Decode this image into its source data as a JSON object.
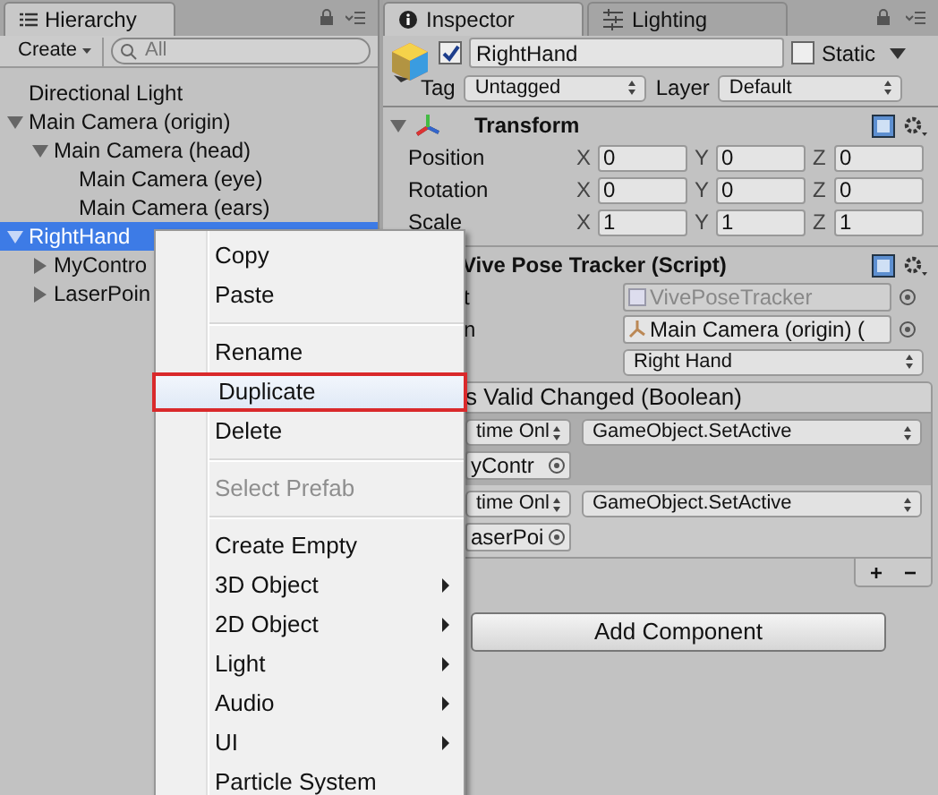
{
  "hierarchy": {
    "tab": "Hierarchy",
    "create": "Create",
    "search": {
      "placeholder": "All"
    },
    "items": [
      {
        "label": "Directional Light",
        "selected": false
      },
      {
        "label": "Main Camera (origin)",
        "expanded": true,
        "selected": false,
        "children": [
          {
            "label": "Main Camera (head)",
            "expanded": true,
            "selected": false,
            "children": [
              {
                "label": "Main Camera (eye)",
                "selected": false
              },
              {
                "label": "Main Camera (ears)",
                "selected": false
              }
            ]
          }
        ]
      },
      {
        "label": "RightHand",
        "expanded": true,
        "selected": true,
        "children": [
          {
            "label": "MyContro",
            "expanded": false,
            "selected": false
          },
          {
            "label": "LaserPoin",
            "expanded": false,
            "selected": false
          }
        ]
      }
    ]
  },
  "inspector": {
    "tabs": [
      {
        "label": "Inspector",
        "selected": true
      },
      {
        "label": "Lighting",
        "selected": false
      }
    ],
    "object": {
      "active": true,
      "name": "RightHand",
      "static": false,
      "static_label": "Static",
      "tag_label": "Tag",
      "tag": "Untagged",
      "layer_label": "Layer",
      "layer": "Default"
    },
    "transform": {
      "title": "Transform",
      "expanded": true,
      "rows": [
        {
          "label": "Position",
          "fields": [
            {
              "axis": "X",
              "value": "0"
            },
            {
              "axis": "Y",
              "value": "0"
            },
            {
              "axis": "Z",
              "value": "0"
            }
          ]
        },
        {
          "label": "Rotation",
          "fields": [
            {
              "axis": "X",
              "value": "0"
            },
            {
              "axis": "Y",
              "value": "0"
            },
            {
              "axis": "Z",
              "value": "0"
            }
          ]
        },
        {
          "label": "Scale",
          "fields": [
            {
              "axis": "X",
              "value": "1"
            },
            {
              "axis": "Y",
              "value": "1"
            },
            {
              "axis": "Z",
              "value": "1"
            }
          ]
        }
      ]
    },
    "script": {
      "title": "Vive Pose Tracker (Script)",
      "fields": [
        {
          "label": "t",
          "value": "VivePoseTracker",
          "kind": "script"
        },
        {
          "label": "n",
          "value": "Main Camera (origin) (",
          "kind": "object"
        },
        {
          "value": "Right Hand",
          "kind": "dropdown"
        }
      ],
      "event": {
        "title": "s Valid Changed (Boolean)",
        "listeners": [
          {
            "runtime": "time Onl",
            "function": "GameObject.SetActive",
            "target": "yContr",
            "selected": true
          },
          {
            "runtime": "time Onl",
            "function": "GameObject.SetActive",
            "target": "aserPoi",
            "selected": false
          }
        ],
        "add": "+",
        "remove": "−"
      }
    },
    "add_component": "Add Component"
  },
  "context_menu": [
    {
      "kind": "item",
      "label": "Copy",
      "disabled": false,
      "selected": false,
      "submenu": false
    },
    {
      "kind": "item",
      "label": "Paste",
      "disabled": false,
      "selected": false,
      "submenu": false
    },
    {
      "kind": "separator"
    },
    {
      "kind": "item",
      "label": "Rename",
      "disabled": false,
      "selected": false,
      "submenu": false
    },
    {
      "kind": "item",
      "label": "Duplicate",
      "disabled": false,
      "selected": true,
      "submenu": false
    },
    {
      "kind": "item",
      "label": "Delete",
      "disabled": false,
      "selected": false,
      "submenu": false
    },
    {
      "kind": "separator"
    },
    {
      "kind": "item",
      "label": "Select Prefab",
      "disabled": true,
      "selected": false,
      "submenu": false
    },
    {
      "kind": "separator"
    },
    {
      "kind": "item",
      "label": "Create Empty",
      "disabled": false,
      "selected": false,
      "submenu": false
    },
    {
      "kind": "item",
      "label": "3D Object",
      "disabled": false,
      "selected": false,
      "submenu": true
    },
    {
      "kind": "item",
      "label": "2D Object",
      "disabled": false,
      "selected": false,
      "submenu": true
    },
    {
      "kind": "item",
      "label": "Light",
      "disabled": false,
      "selected": false,
      "submenu": true
    },
    {
      "kind": "item",
      "label": "Audio",
      "disabled": false,
      "selected": false,
      "submenu": true
    },
    {
      "kind": "item",
      "label": "UI",
      "disabled": false,
      "selected": false,
      "submenu": true
    },
    {
      "kind": "item",
      "label": "Particle System",
      "disabled": false,
      "selected": false,
      "submenu": false
    }
  ]
}
